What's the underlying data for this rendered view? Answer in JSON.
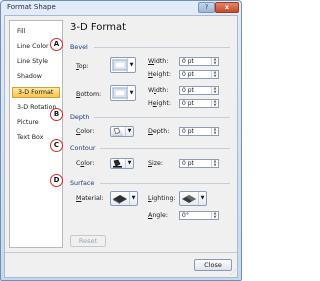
{
  "window": {
    "title": "Format Shape",
    "help_glyph": "?",
    "close_glyph": "x"
  },
  "nav": {
    "items": [
      {
        "label": "Fill"
      },
      {
        "label": "Line Color"
      },
      {
        "label": "Line Style"
      },
      {
        "label": "Shadow"
      },
      {
        "label": "3-D Format",
        "selected": true
      },
      {
        "label": "3-D Rotation"
      },
      {
        "label": "Picture"
      },
      {
        "label": "Text Box"
      }
    ]
  },
  "panel": {
    "title": "3-D Format",
    "bevel": {
      "heading": "Bevel",
      "top_label": "Top:",
      "bottom_label": "Bottom:",
      "top_width_label": "Width:",
      "top_width_value": "0 pt",
      "top_height_label": "Height:",
      "top_height_value": "0 pt",
      "bottom_width_label": "Width:",
      "bottom_width_value": "0 pt",
      "bottom_height_label": "Height:",
      "bottom_height_value": "0 pt"
    },
    "depth": {
      "heading": "Depth",
      "color_label": "Color:",
      "depth_label": "Depth:",
      "depth_value": "0 pt"
    },
    "contour": {
      "heading": "Contour",
      "color_label": "Color:",
      "size_label": "Size:",
      "size_value": "0 pt"
    },
    "surface": {
      "heading": "Surface",
      "material_label": "Material:",
      "lighting_label": "Lighting:",
      "angle_label": "Angle:",
      "angle_value": "0°"
    },
    "reset_label": "Reset"
  },
  "callouts": [
    "A",
    "B",
    "C",
    "D"
  ],
  "footer": {
    "close_label": "Close"
  },
  "colors": {
    "accent_selected": "#f7c44c",
    "callout_ring": "#d42a2a",
    "section_text": "#1a3d7a"
  }
}
